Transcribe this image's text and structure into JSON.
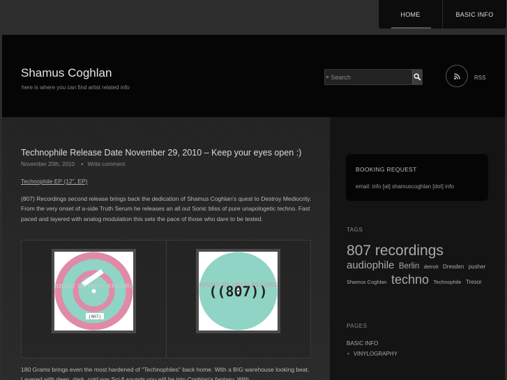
{
  "nav": {
    "items": [
      {
        "label": "HOME",
        "active": true
      },
      {
        "label": "BASIC INFO",
        "active": false
      }
    ]
  },
  "header": {
    "title": "Shamus Coghlan",
    "description": "here is where you can find artist related info",
    "search_placeholder": "Search",
    "rss_label": "RSS"
  },
  "post": {
    "title": "Technophile Release Date November 29, 2010 – Keep your eyes open :)",
    "date": "November 20th, 2010",
    "comment_link": "Write comment",
    "ep_link": "Technophile EP (12\", EP)",
    "body": "(807) Recordings second release brings back the dedication of Shamus Coghlan's quest to Destroy Mediocrity. From the very onset of a-side Truth Serum he releases an all out Sonic bliss of pure unapologetic techno. Fast paced and layered with analog modulation this sets the pace of those who dare to be tested.",
    "body2": "180 Grams brings even the most hardened of \"Technophiles\" back home. With a BIG warehouse looking beat. Layered with deep, dark, cold war Sci-fi sounds you will be into Coghlan's fantasy. With",
    "images": [
      {
        "watermark": "COPYRIGHT BY (807) RECORDINGS",
        "label": "(807)"
      },
      {
        "watermark": "COPYRIGHT BY (807) RECORDINGS",
        "label": "((807))"
      }
    ]
  },
  "sidebar": {
    "booking": {
      "title": "BOOKING REQUEST",
      "email": "email: info [at] shamuscoghlan [dot] info"
    },
    "tags_title": "TAGS",
    "tags": [
      {
        "label": "807 recordings",
        "size": 21
      },
      {
        "label": "audiophile",
        "size": 15
      },
      {
        "label": "Berlin",
        "size": 11.5
      },
      {
        "label": "detroit",
        "size": 7.5
      },
      {
        "label": "Dresden",
        "size": 8
      },
      {
        "label": "pusher",
        "size": 8
      },
      {
        "label": "Shamus Coghlan",
        "size": 7.5
      },
      {
        "label": "techno",
        "size": 18
      },
      {
        "label": "Technophile",
        "size": 7.5
      },
      {
        "label": "Tresor",
        "size": 8
      }
    ],
    "pages_title": "PAGES",
    "pages": {
      "top": "BASIC INFO",
      "sub": "VINYLOGRAPHY"
    }
  },
  "colors": {
    "accent_pink": "#e08aa8",
    "accent_teal": "#8fd4c4"
  }
}
